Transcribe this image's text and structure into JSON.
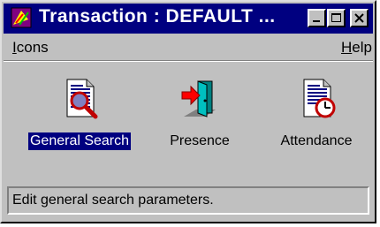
{
  "window": {
    "title": "Transaction  : DEFAULT ..."
  },
  "menu": {
    "items": [
      {
        "label": "Icons"
      },
      {
        "label": "Help"
      }
    ]
  },
  "tools": [
    {
      "label": "General Search",
      "icon": "search-document-icon",
      "selected": true
    },
    {
      "label": "Presence",
      "icon": "door-icon",
      "selected": false
    },
    {
      "label": "Attendance",
      "icon": "clock-document-icon",
      "selected": false
    }
  ],
  "status": {
    "text": "Edit general search parameters."
  },
  "colors": {
    "titlebar": "#000080",
    "face": "#c0c0c0",
    "selection": "#000080"
  }
}
